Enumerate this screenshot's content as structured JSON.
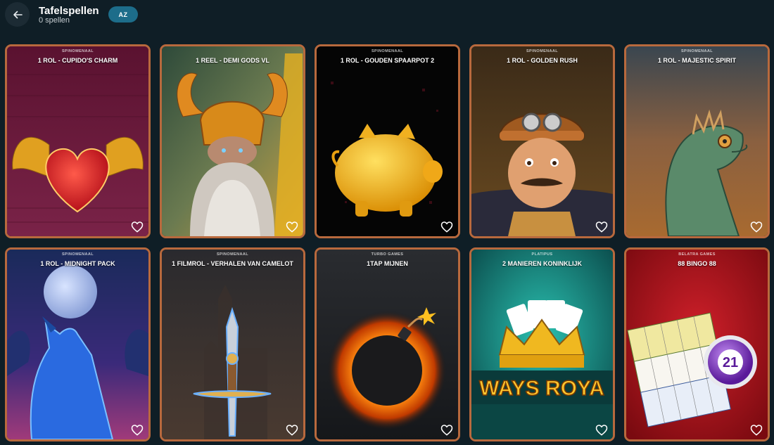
{
  "header": {
    "title": "Tafelspellen",
    "subtitle": "0 spellen",
    "sort_label": "AZ"
  },
  "games": [
    {
      "provider": "SPINOMENAAL",
      "name": "1 ROL - CUPIDO'S CHARM",
      "art": "winged-heart"
    },
    {
      "provider": "",
      "name": "1 REEL - DEMI GODS VL",
      "art": "viking-god"
    },
    {
      "provider": "SPINOMENAAL",
      "name": "1 ROL - GOUDEN SPAARPOT 2",
      "art": "piggy-bank"
    },
    {
      "provider": "SPINOMENAAL",
      "name": "1 ROL - GOLDEN RUSH",
      "art": "miner"
    },
    {
      "provider": "SPINOMENAAL",
      "name": "1 ROL - MAJESTIC SPIRIT",
      "art": "iguana"
    },
    {
      "provider": "SPINOMENAAL",
      "name": "1 ROL - MIDNIGHT PACK",
      "art": "wolf-moon"
    },
    {
      "provider": "SPINOMENAAL",
      "name": "1 FILMROL - VERHALEN VAN CAMELOT",
      "art": "sword"
    },
    {
      "provider": "TURBO GAMES",
      "name": "1TAP MIJNEN",
      "art": "bomb"
    },
    {
      "provider": "PLATIPUS",
      "name": "2 MANIEREN KONINKLIJK",
      "art": "crown-cards",
      "art_text": "WAYS ROYA"
    },
    {
      "provider": "BELATRA GAMES",
      "name": "88 BINGO 88",
      "art": "bingo",
      "art_text": "21"
    }
  ],
  "colors": {
    "background": "#0f1e26",
    "tile_border": "#b8693d",
    "sort_button": "#1d6d8a"
  },
  "icons": {
    "back": "arrow-left-icon",
    "favorite": "heart-outline-icon"
  }
}
